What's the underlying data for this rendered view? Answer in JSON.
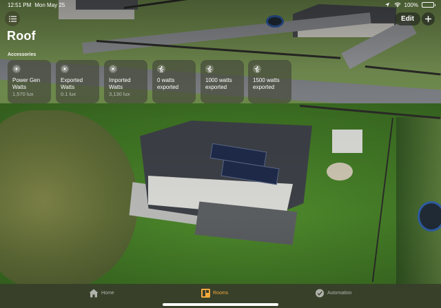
{
  "status_bar": {
    "time": "12:51 PM",
    "date": "Mon May 25",
    "battery_percent": "100%",
    "battery_level": 1.0
  },
  "header": {
    "title": "Roof",
    "edit_label": "Edit",
    "list_icon": "list-icon",
    "add_icon": "plus-icon"
  },
  "accessories": {
    "section_label": "Accessories",
    "tiles": [
      {
        "name": "Power Gen Watts",
        "value": "1,570 lux",
        "icon": "light-sensor-icon"
      },
      {
        "name": "Exported Watts",
        "value": "0.1 lux",
        "icon": "light-sensor-icon"
      },
      {
        "name": "Imported Watts",
        "value": "3,130 lux",
        "icon": "light-sensor-icon"
      },
      {
        "name": "0 watts exported",
        "value": "",
        "icon": "motion-sensor-icon"
      },
      {
        "name": "1000 watts exported",
        "value": "",
        "icon": "motion-sensor-icon"
      },
      {
        "name": "1500 watts exported",
        "value": "",
        "icon": "motion-sensor-icon"
      }
    ]
  },
  "tab_bar": {
    "tabs": [
      {
        "label": "Home",
        "icon": "house-icon",
        "active": false
      },
      {
        "label": "Rooms",
        "icon": "rooms-icon",
        "active": true
      },
      {
        "label": "Automation",
        "icon": "automation-icon",
        "active": false
      }
    ]
  },
  "colors": {
    "accent": "#f3a93c",
    "tile_background": "#464b3c",
    "tab_bar_background": "#373e2a"
  }
}
